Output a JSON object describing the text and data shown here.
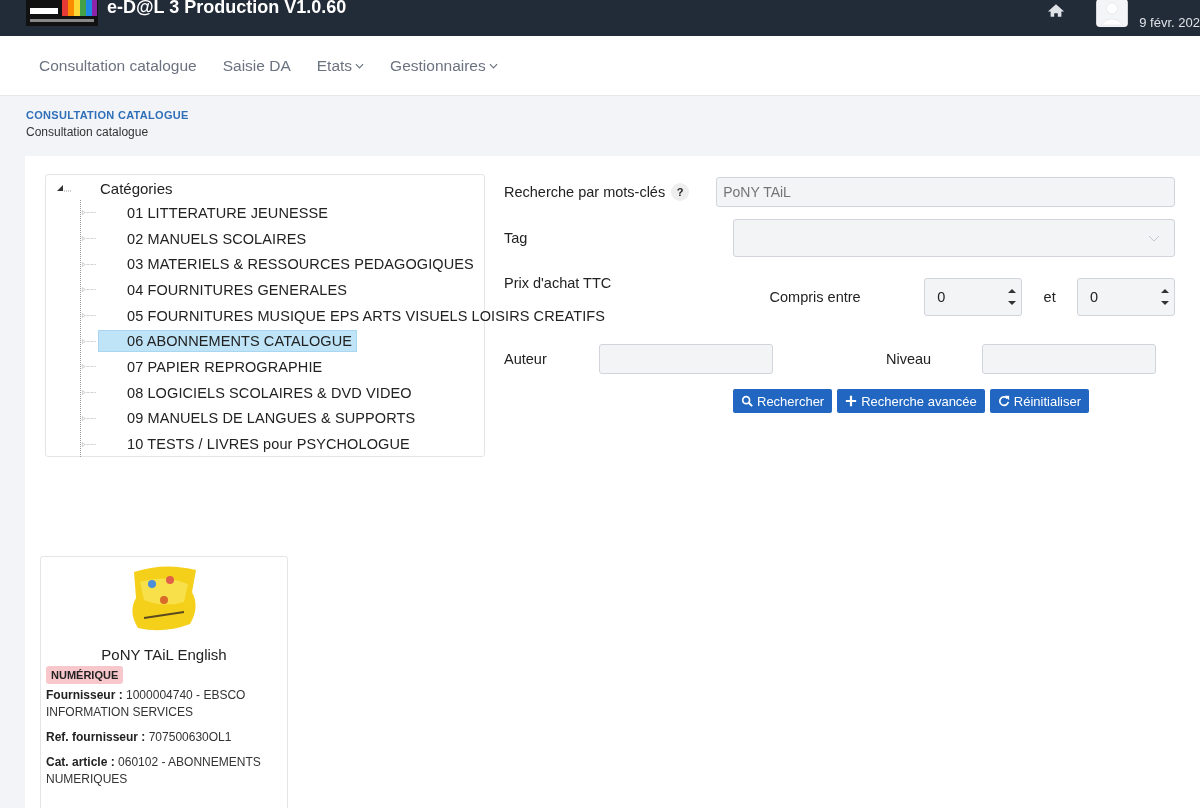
{
  "header": {
    "title": "e-D@L 3 Production V1.0.60",
    "date": "9 févr. 202"
  },
  "nav": [
    {
      "label": "Consultation catalogue",
      "dropdown": false
    },
    {
      "label": "Saisie DA",
      "dropdown": false
    },
    {
      "label": "Etats",
      "dropdown": true
    },
    {
      "label": "Gestionnaires",
      "dropdown": true
    }
  ],
  "breadcrumb": {
    "section": "CONSULTATION CATALOGUE",
    "page": "Consultation catalogue"
  },
  "tree": {
    "label": "Catégories",
    "expanded": true,
    "children": [
      {
        "label": "01 LITTERATURE JEUNESSE",
        "selected": false
      },
      {
        "label": "02 MANUELS SCOLAIRES",
        "selected": false
      },
      {
        "label": "03 MATERIELS & RESSOURCES PEDAGOGIQUES",
        "selected": false
      },
      {
        "label": "04 FOURNITURES GENERALES",
        "selected": false
      },
      {
        "label": "05 FOURNITURES MUSIQUE EPS ARTS VISUELS LOISIRS CREATIFS",
        "selected": false
      },
      {
        "label": "06 ABONNEMENTS CATALOGUE",
        "selected": true
      },
      {
        "label": "07 PAPIER REPROGRAPHIE",
        "selected": false
      },
      {
        "label": "08 LOGICIELS SCOLAIRES & DVD VIDEO",
        "selected": false
      },
      {
        "label": "09 MANUELS DE LANGUES & SUPPORTS",
        "selected": false
      },
      {
        "label": "10 TESTS / LIVRES pour PSYCHOLOGUE",
        "selected": false
      }
    ]
  },
  "form": {
    "keywords_label": "Recherche par mots-clés",
    "help": "?",
    "keywords_placeholder": "PoNY TAiL",
    "tag_label": "Tag",
    "price_label": "Prix d'achat TTC",
    "between_label": "Compris entre",
    "min": "0",
    "and_label": "et",
    "max": "0",
    "author_label": "Auteur",
    "level_label": "Niveau",
    "buttons": [
      {
        "label": "Rechercher",
        "kind": "search"
      },
      {
        "label": "Recherche avancée",
        "kind": "plus"
      },
      {
        "label": "Réinitialiser",
        "kind": "reset"
      }
    ]
  },
  "products": [
    {
      "image": {
        "kind": "picture"
      },
      "name": "PoNY TAiL English",
      "badge": "NUMÉRIQUE",
      "fields": [
        {
          "label": "Fournisseur :",
          "value": "1000004740 - EBSCO INFORMATION SERVICES"
        },
        {
          "label": "Ref. fournisseur :",
          "value": "707500630OL1"
        },
        {
          "label": "Cat. article :",
          "value": "060102 - ABONNEMENTS NUMERIQUES"
        }
      ]
    }
  ]
}
